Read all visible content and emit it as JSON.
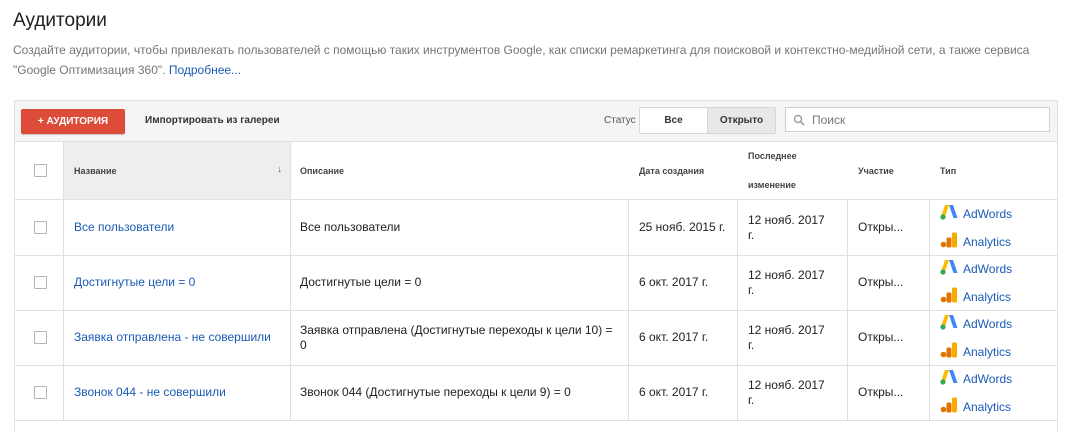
{
  "header": {
    "title": "Аудитории",
    "description": "Создайте аудитории, чтобы привлекать пользователей с помощью таких инструментов Google, как списки ремаркетинга для поисковой и контекстно-медийной сети, а также сервиса \"Google Оптимизация 360\".",
    "more_link": "Подробнее..."
  },
  "toolbar": {
    "add_label": "+ АУДИТОРИЯ",
    "import_label": "Импортировать из галереи",
    "status_label": "Статус",
    "status_options": [
      "Все",
      "Открыто"
    ],
    "status_selected": "Открыто",
    "search_placeholder": "Поиск"
  },
  "table": {
    "columns": {
      "name": "Название",
      "description": "Описание",
      "created": "Дата создания",
      "modified_line1": "Последнее",
      "modified_line2": "изменение",
      "participation": "Участие",
      "type": "Тип"
    },
    "rows": [
      {
        "name": "Все пользователи",
        "description": "Все пользователи",
        "created": "25 нояб. 2015 г.",
        "modified": "12 нояб. 2017 г.",
        "participation": "Откры...",
        "types": [
          "AdWords",
          "Analytics"
        ]
      },
      {
        "name": "Достигнутые цели = 0",
        "description": "Достигнутые цели = 0",
        "created": "6 окт. 2017 г.",
        "modified": "12 нояб. 2017 г.",
        "participation": "Откры...",
        "types": [
          "AdWords",
          "Analytics"
        ]
      },
      {
        "name": "Заявка отправлена - не совершили",
        "description": "Заявка отправлена (Достигнутые переходы к цели 10) = 0",
        "created": "6 окт. 2017 г.",
        "modified": "12 нояб. 2017 г.",
        "participation": "Откры...",
        "types": [
          "AdWords",
          "Analytics"
        ]
      },
      {
        "name": "Звонок 044 - не совершили",
        "description": "Звонок 044 (Достигнутые переходы к цели 9) = 0",
        "created": "6 окт. 2017 г.",
        "modified": "12 нояб. 2017 г.",
        "participation": "Откры...",
        "types": [
          "AdWords",
          "Analytics"
        ]
      }
    ]
  },
  "colors": {
    "accent_red": "#dd4b39",
    "link_blue": "#1a5ab4",
    "adwords_blue": "#4285f4",
    "adwords_yellow": "#fbbc04",
    "adwords_green": "#34a853",
    "analytics_orange": "#f9ab00"
  },
  "icons": {
    "search": "search-icon",
    "sort": "sort-arrow-down-icon",
    "adwords": "adwords-logo-icon",
    "analytics": "analytics-logo-icon"
  }
}
